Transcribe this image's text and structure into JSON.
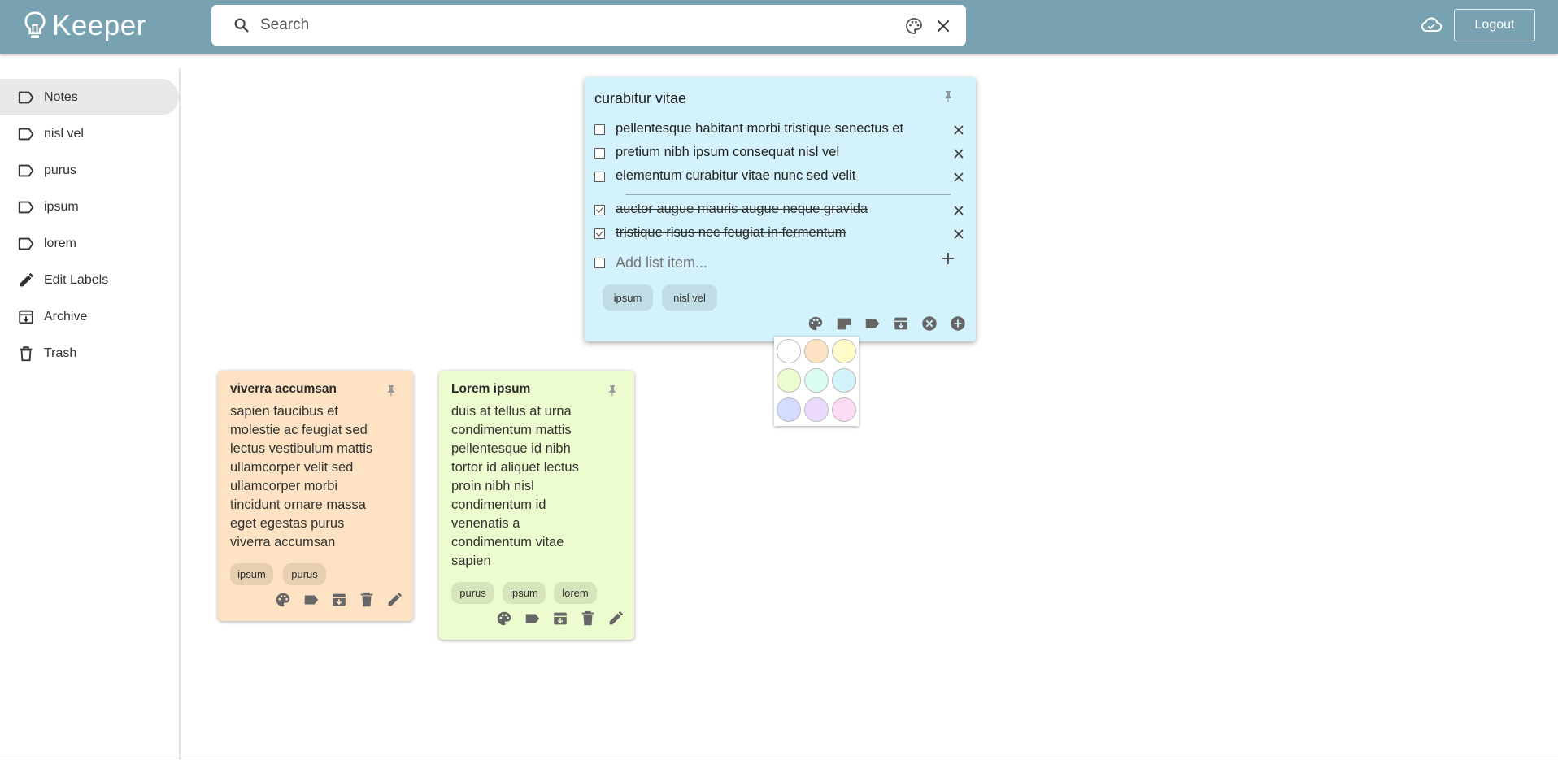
{
  "app": {
    "title": "Keeper"
  },
  "header": {
    "search_placeholder": "Search",
    "logout_label": "Logout"
  },
  "sidebar": {
    "items": [
      {
        "label": "Notes",
        "icon": "label-icon",
        "active": true
      },
      {
        "label": "nisl vel",
        "icon": "label-outline-icon"
      },
      {
        "label": "purus",
        "icon": "label-outline-icon"
      },
      {
        "label": "ipsum",
        "icon": "label-outline-icon"
      },
      {
        "label": "lorem",
        "icon": "label-outline-icon"
      },
      {
        "label": "Edit Labels",
        "icon": "pencil-icon"
      },
      {
        "label": "Archive",
        "icon": "archive-icon"
      },
      {
        "label": "Trash",
        "icon": "trash-icon"
      }
    ]
  },
  "editing_note": {
    "title": "curabitur vitae",
    "color": "#d4f2fb",
    "unchecked": [
      "pellentesque habitant morbi tristique senectus et",
      "pretium nibh ipsum consequat nisl vel",
      "elementum curabitur vitae nunc sed velit"
    ],
    "checked": [
      "auctor augue mauris augue neque gravida",
      "tristique risus nec feugiat in fermentum"
    ],
    "add_placeholder": "Add list item...",
    "labels": [
      "ipsum",
      "nisl vel"
    ]
  },
  "palette": {
    "colors": [
      "#ffffff",
      "#fde3c3",
      "#fffbc8",
      "#edfccf",
      "#dbfcf3",
      "#d4f2fb",
      "#d6dcfe",
      "#ebdafe",
      "#fcdcf4"
    ]
  },
  "notes": [
    {
      "title": "viverra accumsan",
      "color": "#fde3c3",
      "lines": [
        "sapien faucibus et",
        "molestie ac feugiat sed",
        "lectus vestibulum mattis",
        "ullamcorper velit sed",
        "ullamcorper morbi",
        "tincidunt ornare massa",
        "eget egestas purus",
        "viverra accumsan"
      ],
      "labels": [
        "ipsum",
        "purus"
      ]
    },
    {
      "title": "Lorem ipsum",
      "color": "#edfccf",
      "lines": [
        "duis at tellus at urna",
        "condimentum mattis",
        "pellentesque id nibh",
        "tortor id aliquet lectus",
        "proin nibh nisl",
        "condimentum id",
        "venenatis a",
        "condimentum vitae",
        "sapien"
      ],
      "labels": [
        "purus",
        "ipsum",
        "lorem"
      ]
    }
  ]
}
